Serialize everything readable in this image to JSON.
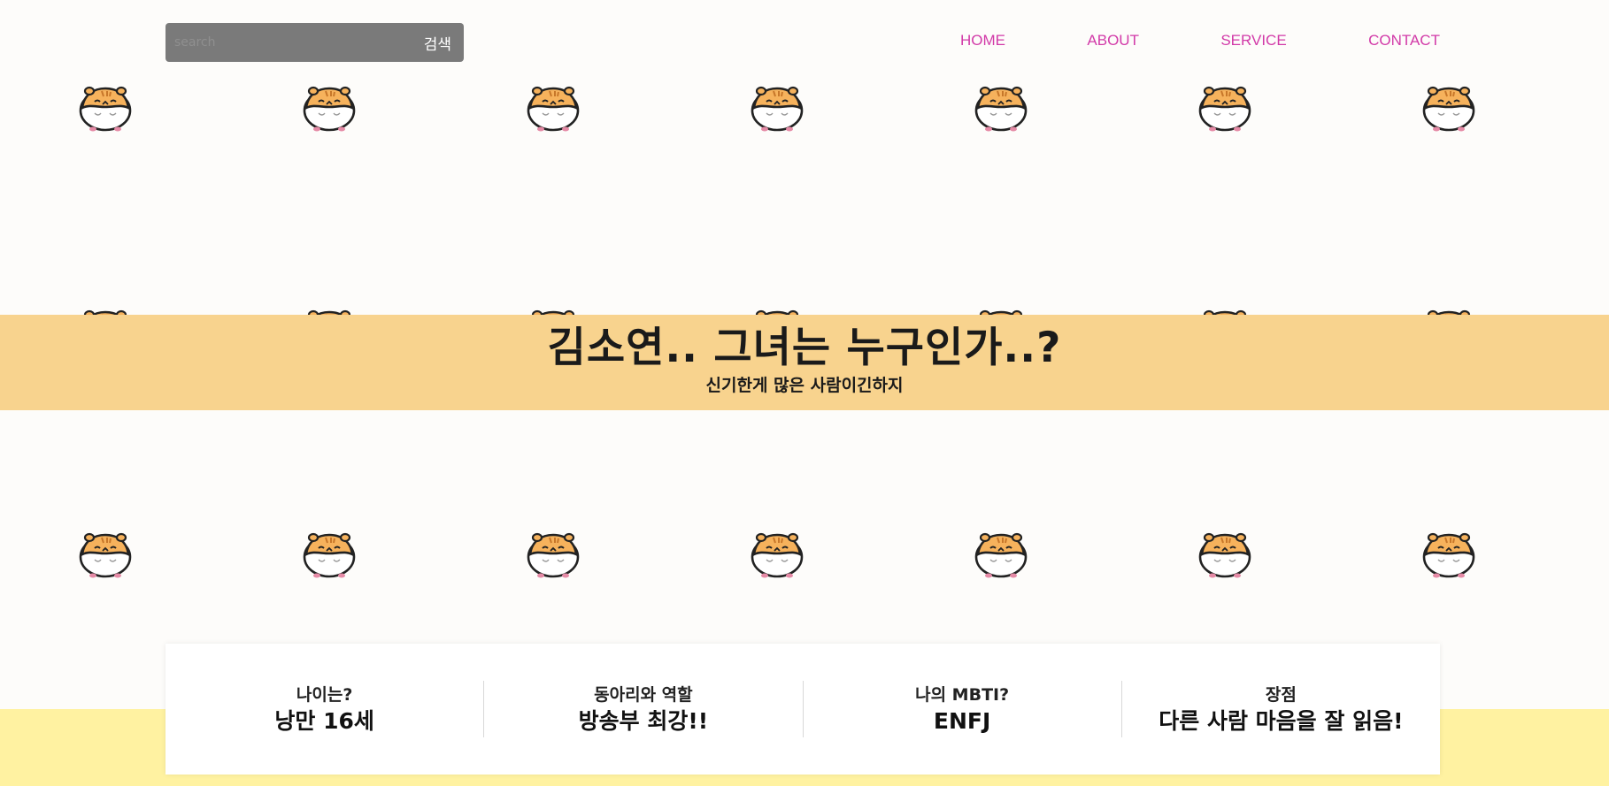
{
  "search": {
    "placeholder": "search",
    "button_label": "검색"
  },
  "nav": {
    "items": [
      "HOME",
      "ABOUT",
      "SERVICE",
      "CONTACT"
    ]
  },
  "colors": {
    "nav_link": "#d23aa8",
    "banner_bg": "#f8d38e",
    "footer_band": "#fff2a1",
    "search_bg": "#7a7a7a"
  },
  "icons": {
    "pattern": "hamster-icon"
  },
  "banner": {
    "title": "김소연.. 그녀는 누구인가..?",
    "subtitle": "신기한게 많은 사람이긴하지"
  },
  "info": {
    "items": [
      {
        "question": "나이는?",
        "answer": "낭만 16세"
      },
      {
        "question": "동아리와 역할",
        "answer": "방송부 최강!!"
      },
      {
        "question": "나의 MBTI?",
        "answer": "ENFJ"
      },
      {
        "question": "장점",
        "answer": "다른 사람 마음을 잘 읽음!"
      }
    ]
  }
}
